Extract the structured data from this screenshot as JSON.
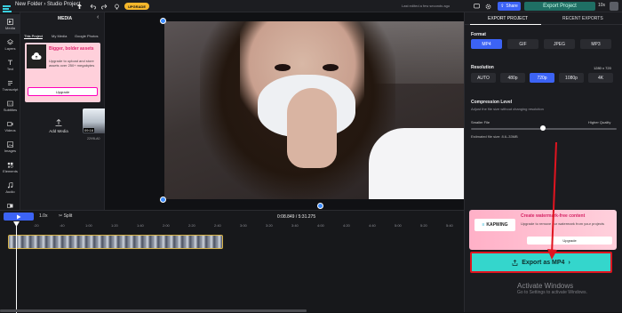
{
  "topbar": {
    "project_path": "New Folder › Studio Project",
    "upgrade_label": "UPGRADE",
    "saved_text": "Last edited a few seconds ago",
    "share_label": "Share",
    "export_label": "Export Project",
    "zoom_label": "10s"
  },
  "leftnav": {
    "items": [
      {
        "label": "Media",
        "icon": "media-icon"
      },
      {
        "label": "Layers",
        "icon": "layers-icon"
      },
      {
        "label": "Text",
        "icon": "text-icon"
      },
      {
        "label": "Transcript",
        "icon": "transcript-icon"
      },
      {
        "label": "Subtitles",
        "icon": "subtitles-icon"
      },
      {
        "label": "Videos",
        "icon": "videos-icon"
      },
      {
        "label": "Images",
        "icon": "images-icon"
      },
      {
        "label": "Elements",
        "icon": "elements-icon"
      },
      {
        "label": "Audio",
        "icon": "audio-icon"
      },
      {
        "label": "Transitions",
        "icon": "transitions-icon"
      }
    ]
  },
  "media_panel": {
    "title": "MEDIA",
    "tabs": [
      "This Project",
      "My Media",
      "Google Photos"
    ],
    "promo": {
      "title": "Bigger, bolder assets",
      "body": "Upgrade to upload and store assets over 250+ megabytes",
      "button": "Upgrade"
    },
    "add_media_label": "Add Media",
    "clip": {
      "duration": "09:16",
      "name": "22V9LA0"
    }
  },
  "right_panel": {
    "tabs": [
      "EXPORT PROJECT",
      "RECENT EXPORTS"
    ],
    "format": {
      "label": "Format",
      "options": [
        "MP4",
        "GIF",
        "JPEG",
        "MP3"
      ],
      "selected": "MP4"
    },
    "resolution": {
      "label": "Resolution",
      "value": "1280 x 720",
      "options": [
        "AUTO",
        "480p",
        "720p",
        "1080p",
        "4K"
      ],
      "selected": "720p"
    },
    "compression": {
      "label": "Compression Level",
      "subtitle": "Adjust the file size without changing resolution",
      "left": "Smaller File",
      "right": "Higher Quality",
      "level": 0.55
    },
    "estimated": "Estimated file size: 8.6–33MB",
    "watermark": {
      "brand": "KAPWING",
      "title": "Create watermark-free content",
      "body": "Upgrade to remove our watermark from your projects",
      "button": "Upgrade"
    },
    "export_button": "Export as MP4",
    "activate_title": "Activate Windows",
    "activate_sub": "Go to Settings to activate Windows."
  },
  "timeline": {
    "speed": "1.0x",
    "split_label": "Split",
    "timecode": "0:08.849 / 5:31.275",
    "ticks": [
      ":20",
      ":40",
      "1:00",
      "1:20",
      "1:40",
      "2:00",
      "2:20",
      "2:40",
      "3:00",
      "3:20",
      "3:40",
      "4:00",
      "4:20",
      "4:40",
      "5:00",
      "5:20",
      "5:40"
    ]
  },
  "colors": {
    "accent": "#3c63f5",
    "export_teal": "#34d6cc",
    "annotation_red": "#e0141f",
    "upgrade_yellow": "#f6b72b"
  }
}
